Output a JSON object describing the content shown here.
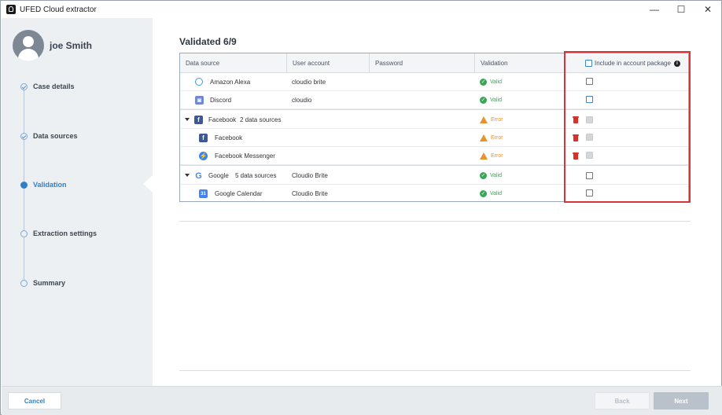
{
  "window": {
    "title": "UFED Cloud extractor",
    "controls": {
      "minimize": "—",
      "maximize": "☐",
      "close": "✕"
    }
  },
  "sidebar": {
    "user_name": "joe Smith",
    "steps": [
      {
        "label": "Case details",
        "state": "done"
      },
      {
        "label": "Data sources",
        "state": "done"
      },
      {
        "label": "Validation",
        "state": "active"
      },
      {
        "label": "Extraction settings",
        "state": "pending"
      },
      {
        "label": "Summary",
        "state": "pending"
      }
    ]
  },
  "main": {
    "title": "Validated 6/9",
    "columns": {
      "data_source": "Data source",
      "user_account": "User account",
      "password": "Password",
      "validation": "Validation",
      "include": "Include in account package"
    },
    "rows": [
      {
        "name": "Amazon Alexa",
        "account": "cloudio brite",
        "status": "Valid",
        "icon": "alexa-icon"
      },
      {
        "name": "Discord",
        "account": "cloudio",
        "status": "Valid",
        "icon": "discord-icon"
      },
      {
        "name": "Facebook",
        "sub": "2 data sources",
        "account": "",
        "status": "Error",
        "icon": "facebook-icon"
      },
      {
        "name": "Facebook",
        "account": "",
        "status": "Error",
        "icon": "facebook-icon"
      },
      {
        "name": "Facebook Messenger",
        "account": "",
        "status": "Error",
        "icon": "messenger-icon"
      },
      {
        "name": "Google",
        "sub": "5 data sources",
        "account": "Cloudio Brite",
        "status": "Valid",
        "icon": "google-icon"
      },
      {
        "name": "Google Calendar",
        "account": "Cloudio Brite",
        "status": "Valid",
        "icon": "google-calendar-icon"
      }
    ]
  },
  "footer": {
    "cancel": "Cancel",
    "back": "Back",
    "next": "Next"
  },
  "colors": {
    "accent": "#2f80c8",
    "valid": "#3aa655",
    "error": "#e8922f",
    "highlight": "#d6343a",
    "delete": "#d9302c"
  }
}
